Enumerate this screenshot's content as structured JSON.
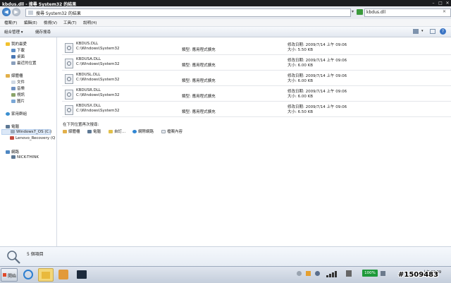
{
  "window": {
    "title": "kbdus.dll - 搜尋 System32 的結果"
  },
  "address": {
    "path": "搜尋 System32 的結果",
    "search_value": "kbdus.dll"
  },
  "menu": [
    "檔案(F)",
    "編輯(E)",
    "檢視(V)",
    "工具(T)",
    "說明(H)"
  ],
  "toolbar": {
    "organize": "組合管理",
    "save_search": "儲存搜尋"
  },
  "nav": {
    "favorites": "我的最愛",
    "downloads": "下載",
    "desktop": "桌面",
    "recent": "最近的位置",
    "libraries": "媒體櫃",
    "documents": "文件",
    "music": "音樂",
    "videos": "視訊",
    "pictures": "圖片",
    "homegroup": "家用群組",
    "computer": "電腦",
    "drive_c": "Windows7_OS (C:)",
    "drive_q": "Lenovo_Recovery (Q",
    "network": "網路",
    "pc": "NICK-THINK"
  },
  "results": [
    {
      "name": "KBDUS.DLL",
      "path": "C:\\Windows\\System32",
      "type": "類型: 應用程式擴充",
      "modified": "修改日期: 2009/7/14 上午 09:06",
      "size": "大小: 5.50 KB"
    },
    {
      "name": "KBDUSA.DLL",
      "path": "C:\\Windows\\System32",
      "type": "類型: 應用程式擴充",
      "modified": "修改日期: 2009/7/14 上午 09:06",
      "size": "大小: 6.00 KB"
    },
    {
      "name": "KBDUSL.DLL",
      "path": "C:\\Windows\\System32",
      "type": "類型: 應用程式擴充",
      "modified": "修改日期: 2009/7/14 上午 09:06",
      "size": "大小: 6.00 KB"
    },
    {
      "name": "KBDUSR.DLL",
      "path": "C:\\Windows\\System32",
      "type": "類型: 應用程式擴充",
      "modified": "修改日期: 2009/7/14 上午 09:06",
      "size": "大小: 6.00 KB"
    },
    {
      "name": "KBDUSX.DLL",
      "path": "C:\\Windows\\System32",
      "type": "類型: 應用程式擴充",
      "modified": "修改日期: 2009/7/14 上午 09:06",
      "size": "大小: 6.50 KB"
    }
  ],
  "search_again": {
    "label": "在下列位置再次搜尋:",
    "libraries": "媒體櫃",
    "computer": "電腦",
    "custom": "自訂...",
    "internet": "網際網路",
    "file_contents": "檔案內容"
  },
  "details": {
    "count": "5 個項目"
  },
  "taskbar": {
    "start": "開始",
    "battery": "100%",
    "clock_time": "上午 10:09",
    "watermark": "#1509483"
  }
}
